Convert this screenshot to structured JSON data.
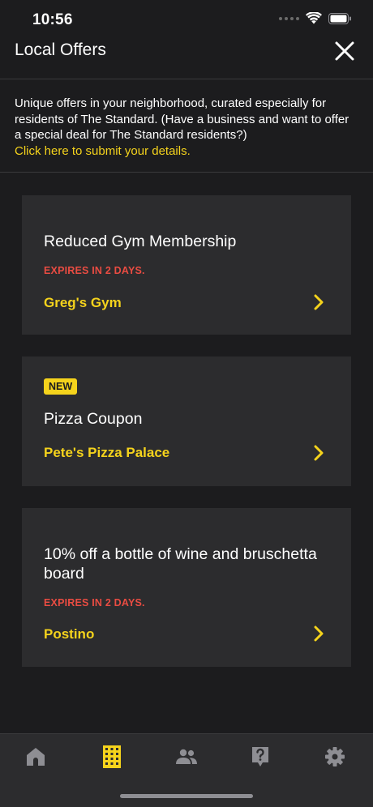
{
  "status_bar": {
    "time": "10:56"
  },
  "header": {
    "title": "Local Offers"
  },
  "intro": {
    "text": "Unique offers in your neighborhood, curated especially for residents of The Standard. (Have a business and want to offer a special deal for The Standard residents?)",
    "link": "Click here to submit your details."
  },
  "offers": [
    {
      "title": "Reduced Gym Membership",
      "expires": "EXPIRES IN 2 DAYS.",
      "business": "Greg's Gym"
    },
    {
      "badge": "NEW",
      "title": "Pizza Coupon",
      "business": "Pete's Pizza Palace"
    },
    {
      "title": "10% off a bottle of wine and bruschetta board",
      "expires": "EXPIRES IN 2 DAYS.",
      "business": "Postino"
    }
  ],
  "tab_bar": {
    "tabs": [
      "home-icon",
      "building-icon",
      "people-icon",
      "help-icon",
      "gear-icon"
    ],
    "active_index": 1
  },
  "colors": {
    "accent": "#f5d31c",
    "expires": "#e94c42",
    "background": "#1c1c1e",
    "card": "#2c2c2e"
  }
}
